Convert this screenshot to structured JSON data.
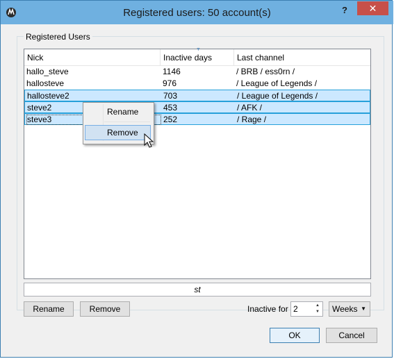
{
  "window": {
    "title": "Registered users: 50 account(s)",
    "help_label": "?",
    "close_label": "✕"
  },
  "group": {
    "label": "Registered Users"
  },
  "table": {
    "columns": [
      "Nick",
      "Inactive days",
      "Last channel"
    ],
    "rows": [
      {
        "nick": "hallo_steve",
        "inactive": "1146",
        "channel": "/ BRB / ess0rn /",
        "selected": false
      },
      {
        "nick": "hallosteve",
        "inactive": "976",
        "channel": "/ League of Legends /",
        "selected": false
      },
      {
        "nick": "hallosteve2",
        "inactive": "703",
        "channel": "/ League of Legends /",
        "selected": true
      },
      {
        "nick": "steve2",
        "inactive": "453",
        "channel": "/ AFK /",
        "selected": true
      },
      {
        "nick": "steve3",
        "inactive": "252",
        "channel": "/ Rage /",
        "selected": true
      }
    ]
  },
  "context_menu": {
    "items": [
      "Rename",
      "Remove"
    ],
    "highlighted": "Remove"
  },
  "filter": {
    "value": "st"
  },
  "buttons": {
    "rename": "Rename",
    "remove": "Remove",
    "ok": "OK",
    "cancel": "Cancel"
  },
  "inactive_filter": {
    "label": "Inactive for",
    "value": "2",
    "unit": "Weeks"
  },
  "colors": {
    "titlebar": "#6fb0e0",
    "close_button": "#c7504a",
    "selection": "#cce8ff"
  },
  "icons": {
    "app": "app-logo-icon",
    "cursor": "mouse-pointer-icon"
  }
}
